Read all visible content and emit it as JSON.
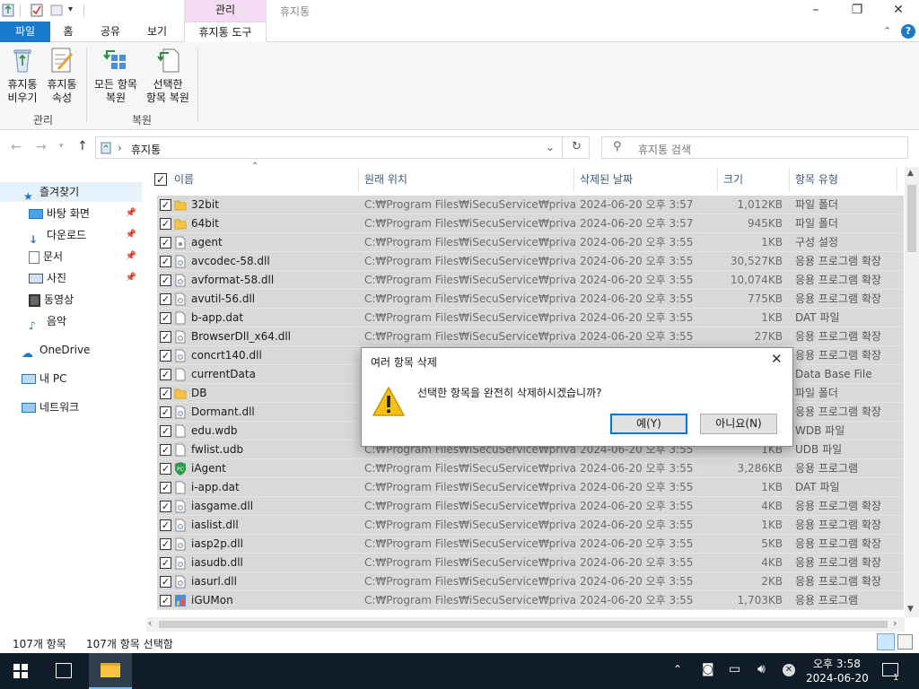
{
  "window": {
    "context_tab": "관리",
    "title": "휴지통"
  },
  "ribbon": {
    "tabs": {
      "file": "파일",
      "home": "홈",
      "share": "공유",
      "view": "보기",
      "tools": "휴지통 도구"
    },
    "empty_bin": [
      "휴지통",
      "비우기"
    ],
    "properties": [
      "휴지통",
      "속성"
    ],
    "restore_all": [
      "모든 항목",
      "복원"
    ],
    "restore_selected": [
      "선택한",
      "항목 복원"
    ],
    "group_manage": "관리",
    "group_restore": "복원"
  },
  "address": {
    "path": "휴지통",
    "search_placeholder": "휴지통 검색"
  },
  "nav": {
    "quick_access": "즐겨찾기",
    "desktop": "바탕 화면",
    "downloads": "다운로드",
    "documents": "문서",
    "pictures": "사진",
    "videos": "동영상",
    "music": "음악",
    "onedrive": "OneDrive",
    "this_pc": "내 PC",
    "network": "네트워크"
  },
  "columns": {
    "name": "이름",
    "location": "원래 위치",
    "deleted": "삭제된 날짜",
    "size": "크기",
    "type": "항목 유형"
  },
  "files": [
    {
      "name": "32bit",
      "loc": "C:₩Program Files₩iSecuService₩private",
      "date": "2024-06-20 오후 3:57",
      "size": "1,012KB",
      "type": "파일 폴더",
      "icon": "folder"
    },
    {
      "name": "64bit",
      "loc": "C:₩Program Files₩iSecuService₩private",
      "date": "2024-06-20 오후 3:57",
      "size": "945KB",
      "type": "파일 폴더",
      "icon": "folder"
    },
    {
      "name": "agent",
      "loc": "C:₩Program Files₩iSecuService₩private",
      "date": "2024-06-20 오후 3:55",
      "size": "1KB",
      "type": "구성 설정",
      "icon": "config"
    },
    {
      "name": "avcodec-58.dll",
      "loc": "C:₩Program Files₩iSecuService₩private",
      "date": "2024-06-20 오후 3:55",
      "size": "30,527KB",
      "type": "응용 프로그램 확장",
      "icon": "dll"
    },
    {
      "name": "avformat-58.dll",
      "loc": "C:₩Program Files₩iSecuService₩private",
      "date": "2024-06-20 오후 3:55",
      "size": "10,074KB",
      "type": "응용 프로그램 확장",
      "icon": "dll"
    },
    {
      "name": "avutil-56.dll",
      "loc": "C:₩Program Files₩iSecuService₩private",
      "date": "2024-06-20 오후 3:55",
      "size": "775KB",
      "type": "응용 프로그램 확장",
      "icon": "dll"
    },
    {
      "name": "b-app.dat",
      "loc": "C:₩Program Files₩iSecuService₩private",
      "date": "2024-06-20 오후 3:55",
      "size": "1KB",
      "type": "DAT 파일",
      "icon": "file"
    },
    {
      "name": "BrowserDll_x64.dll",
      "loc": "C:₩Program Files₩iSecuService₩private",
      "date": "2024-06-20 오후 3:55",
      "size": "27KB",
      "type": "응용 프로그램 확장",
      "icon": "dll"
    },
    {
      "name": "concrt140.dll",
      "loc": "",
      "date": "",
      "size": "",
      "type": "응용 프로그램 확장",
      "icon": "dll"
    },
    {
      "name": "currentData",
      "loc": "",
      "date": "",
      "size": "",
      "type": "Data Base File",
      "icon": "file"
    },
    {
      "name": "DB",
      "loc": "",
      "date": "",
      "size": "",
      "type": "파일 폴더",
      "icon": "folder"
    },
    {
      "name": "Dormant.dll",
      "loc": "",
      "date": "",
      "size": "",
      "type": "응용 프로그램 확장",
      "icon": "dll"
    },
    {
      "name": "edu.wdb",
      "loc": "",
      "date": "",
      "size": "",
      "type": "WDB 파일",
      "icon": "file"
    },
    {
      "name": "fwlist.udb",
      "loc": "C:₩Program Files₩iSecuService₩private",
      "date": "2024-06-20 오후 3:55",
      "size": "1KB",
      "type": "UDB 파일",
      "icon": "file"
    },
    {
      "name": "iAgent",
      "loc": "C:₩Program Files₩iSecuService₩private",
      "date": "2024-06-20 오후 3:55",
      "size": "3,286KB",
      "type": "응용 프로그램",
      "icon": "pc"
    },
    {
      "name": "i-app.dat",
      "loc": "C:₩Program Files₩iSecuService₩private",
      "date": "2024-06-20 오후 3:55",
      "size": "1KB",
      "type": "DAT 파일",
      "icon": "file"
    },
    {
      "name": "iasgame.dll",
      "loc": "C:₩Program Files₩iSecuService₩private",
      "date": "2024-06-20 오후 3:55",
      "size": "4KB",
      "type": "응용 프로그램 확장",
      "icon": "dll"
    },
    {
      "name": "iaslist.dll",
      "loc": "C:₩Program Files₩iSecuService₩private",
      "date": "2024-06-20 오후 3:55",
      "size": "1KB",
      "type": "응용 프로그램 확장",
      "icon": "dll"
    },
    {
      "name": "iasp2p.dll",
      "loc": "C:₩Program Files₩iSecuService₩private",
      "date": "2024-06-20 오후 3:55",
      "size": "5KB",
      "type": "응용 프로그램 확장",
      "icon": "dll"
    },
    {
      "name": "iasudb.dll",
      "loc": "C:₩Program Files₩iSecuService₩private",
      "date": "2024-06-20 오후 3:55",
      "size": "4KB",
      "type": "응용 프로그램 확장",
      "icon": "dll"
    },
    {
      "name": "iasurl.dll",
      "loc": "C:₩Program Files₩iSecuService₩private",
      "date": "2024-06-20 오후 3:55",
      "size": "2KB",
      "type": "응용 프로그램 확장",
      "icon": "dll"
    },
    {
      "name": "iGUMon",
      "loc": "C:₩Program Files₩iSecuService₩private",
      "date": "2024-06-20 오후 3:55",
      "size": "1,703KB",
      "type": "응용 프로그램",
      "icon": "app"
    }
  ],
  "status": {
    "count": "107개 항목",
    "selected": "107개 항목 선택함"
  },
  "dialog": {
    "title": "여러 항목 삭제",
    "message": "선택한 항목을 완전히 삭제하시겠습니까?",
    "yes": "예(Y)",
    "no": "아니요(N)"
  },
  "taskbar": {
    "time": "오후 3:58",
    "date": "2024-06-20",
    "notification_count": "1"
  }
}
